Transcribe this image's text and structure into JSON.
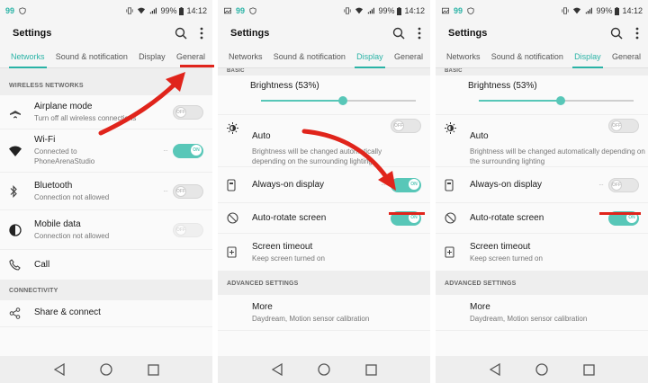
{
  "statusbar": {
    "left_number": "99",
    "battery": "99%",
    "time": "14:12"
  },
  "appbar": {
    "title": "Settings"
  },
  "panel1": {
    "tabs": [
      "Networks",
      "Sound & notification",
      "Display",
      "General"
    ],
    "active_tab": "Networks",
    "highlighted_tab": "General",
    "sections": [
      {
        "header": "WIRELESS NETWORKS",
        "items": [
          {
            "title": "Airplane mode",
            "subtitle": "Turn off all wireless connections",
            "toggle": "OFF"
          },
          {
            "title": "Wi-Fi",
            "subtitle": "Connected to PhoneArenaStudio",
            "toggle": "ON"
          },
          {
            "title": "Bluetooth",
            "subtitle": "Connection not allowed",
            "toggle": "OFF"
          },
          {
            "title": "Mobile data",
            "subtitle": "Connection not allowed",
            "toggle": "OFF"
          },
          {
            "title": "Call"
          }
        ]
      },
      {
        "header": "CONNECTIVITY",
        "items": [
          {
            "title": "Share & connect"
          }
        ]
      }
    ]
  },
  "panel2": {
    "tabs": [
      "Networks",
      "Sound & notification",
      "Display",
      "General"
    ],
    "active_tab": "Display",
    "section_top": "BASIC",
    "brightness_label": "Brightness (53%)",
    "brightness_value": 0.53,
    "auto": {
      "title": "Auto",
      "subtitle": "Brightness will be changed automatically depending on the surrounding lighting",
      "toggle": "OFF"
    },
    "always_on": {
      "title": "Always-on display",
      "toggle": "ON"
    },
    "auto_rotate": {
      "title": "Auto-rotate screen",
      "toggle": "ON"
    },
    "screen_timeout": {
      "title": "Screen timeout",
      "subtitle": "Keep screen turned on"
    },
    "advanced_header": "ADVANCED SETTINGS",
    "more": {
      "title": "More",
      "subtitle": "Daydream, Motion sensor calibration"
    }
  },
  "panel3": {
    "tabs": [
      "Networks",
      "Sound & notification",
      "Display",
      "General"
    ],
    "active_tab": "Display",
    "section_top": "BASIC",
    "brightness_label": "Brightness (53%)",
    "brightness_value": 0.53,
    "auto": {
      "title": "Auto",
      "subtitle": "Brightness will be changed automatically depending on the surrounding lighting",
      "toggle": "OFF"
    },
    "always_on": {
      "title": "Always-on display",
      "toggle": "OFF"
    },
    "auto_rotate": {
      "title": "Auto-rotate screen",
      "toggle": "ON"
    },
    "screen_timeout": {
      "title": "Screen timeout",
      "subtitle": "Keep screen turned on"
    },
    "advanced_header": "ADVANCED SETTINGS",
    "more": {
      "title": "More",
      "subtitle": "Daydream, Motion sensor calibration"
    }
  },
  "colors": {
    "accent": "#2ab3a6",
    "toggle_on": "#58c7b8",
    "annotation_red": "#e0241b"
  },
  "icons": [
    "airplane-icon",
    "wifi-icon",
    "bluetooth-icon",
    "mobile-data-icon",
    "call-icon",
    "share-icon",
    "brightness-auto-icon",
    "always-on-icon",
    "auto-rotate-icon",
    "screen-timeout-icon",
    "search-icon",
    "more-vert-icon",
    "back-icon",
    "home-icon",
    "recents-icon"
  ]
}
